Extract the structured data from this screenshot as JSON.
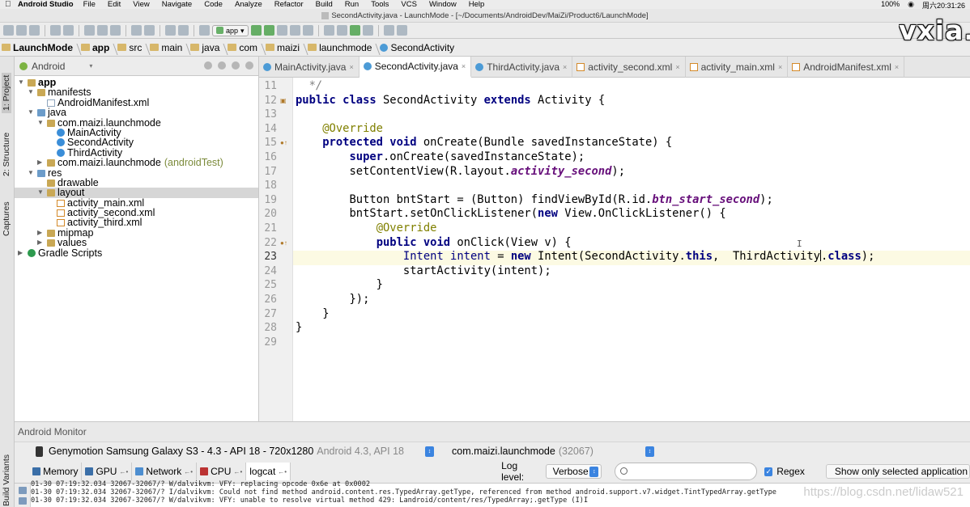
{
  "menubar": {
    "app": "Android Studio",
    "items": [
      "File",
      "Edit",
      "View",
      "Navigate",
      "Code",
      "Analyze",
      "Refactor",
      "Build",
      "Run",
      "Tools",
      "VCS",
      "Window",
      "Help"
    ],
    "battery": "100%",
    "clock": "周六20:31:26"
  },
  "window": {
    "title": "SecondActivity.java - LaunchMode - [~/Documents/AndroidDev/MaiZi/Product6/LaunchMode]"
  },
  "toolbar": {
    "run_config": "app"
  },
  "breadcrumbs": [
    "LaunchMode",
    "app",
    "src",
    "main",
    "java",
    "com",
    "maizi",
    "launchmode",
    "SecondActivity"
  ],
  "left_strip": {
    "tabs": [
      "1: Project",
      "2: Structure",
      "Captures",
      "Build Variants"
    ]
  },
  "project": {
    "view_mode": "Android",
    "tree": [
      {
        "label": "app",
        "bold": true,
        "level": 0,
        "arrow": "open",
        "icon": "folder"
      },
      {
        "label": "manifests",
        "level": 1,
        "arrow": "open",
        "icon": "folder"
      },
      {
        "label": "AndroidManifest.xml",
        "level": 2,
        "icon": "man"
      },
      {
        "label": "java",
        "level": 1,
        "arrow": "open",
        "icon": "folder"
      },
      {
        "label": "com.maizi.launchmode",
        "level": 2,
        "arrow": "open",
        "icon": "pkg"
      },
      {
        "label": "MainActivity",
        "level": 3,
        "icon": "cls"
      },
      {
        "label": "SecondActivity",
        "level": 3,
        "icon": "cls"
      },
      {
        "label": "ThirdActivity",
        "level": 3,
        "icon": "cls"
      },
      {
        "label": "com.maizi.launchmode",
        "suffix": "(androidTest)",
        "level": 2,
        "arrow": "closed",
        "icon": "pkg"
      },
      {
        "label": "res",
        "level": 1,
        "arrow": "open",
        "icon": "folder"
      },
      {
        "label": "drawable",
        "level": 2,
        "icon": "folder"
      },
      {
        "label": "layout",
        "level": 2,
        "arrow": "open",
        "icon": "folder",
        "selected": true
      },
      {
        "label": "activity_main.xml",
        "level": 3,
        "icon": "xml"
      },
      {
        "label": "activity_second.xml",
        "level": 3,
        "icon": "xml"
      },
      {
        "label": "activity_third.xml",
        "level": 3,
        "icon": "xml"
      },
      {
        "label": "mipmap",
        "level": 2,
        "arrow": "closed",
        "icon": "folder"
      },
      {
        "label": "values",
        "level": 2,
        "arrow": "closed",
        "icon": "folder"
      },
      {
        "label": "Gradle Scripts",
        "level": 0,
        "arrow": "closed",
        "icon": "gradle"
      }
    ]
  },
  "editor_tabs": [
    {
      "label": "MainActivity.java",
      "icon": "cls"
    },
    {
      "label": "SecondActivity.java",
      "icon": "cls",
      "active": true
    },
    {
      "label": "ThirdActivity.java",
      "icon": "cls"
    },
    {
      "label": "activity_second.xml",
      "icon": "xml"
    },
    {
      "label": "activity_main.xml",
      "icon": "xml"
    },
    {
      "label": "AndroidManifest.xml",
      "icon": "xml"
    }
  ],
  "editor": {
    "line_numbers": [
      "11",
      "12",
      "13",
      "14",
      "15",
      "16",
      "17",
      "18",
      "19",
      "20",
      "21",
      "22",
      "23",
      "24",
      "25",
      "26",
      "27",
      "28",
      "29"
    ],
    "current_line": "23"
  },
  "monitor": {
    "title": "Android Monitor",
    "device": "Genymotion Samsung Galaxy S3 - 4.3 - API 18 - 720x1280",
    "device_sub": "Android 4.3, API 18",
    "process": "com.maizi.launchmode",
    "pid": "(32067)",
    "tabs": [
      "Memory",
      "GPU",
      "Network",
      "CPU",
      "logcat"
    ],
    "log_level_label": "Log level:",
    "log_level": "Verbose",
    "regex_label": "Regex",
    "filter": "Show only selected application",
    "log_lines": [
      "01-30 07:19:32.034 32067-32067/? W/dalvikvm: VFY: replacing opcode 0x6e at 0x0002",
      "01-30 07:19:32.034 32067-32067/? I/dalvikvm: Could not find method android.content.res.TypedArray.getType, referenced from method android.support.v7.widget.TintTypedArray.getType",
      "01-30 07:19:32.034 32067-32067/? W/dalvikvm: VFY: unable to resolve virtual method 429: Landroid/content/res/TypedArray;.getType (I)I"
    ]
  },
  "watermark": "https://blog.csdn.net/lidaw521",
  "brand": "vxia.n",
  "colors": {
    "keyword": "#000080",
    "annotation": "#808000",
    "field": "#660e7a",
    "current_line": "#fcfae3"
  }
}
